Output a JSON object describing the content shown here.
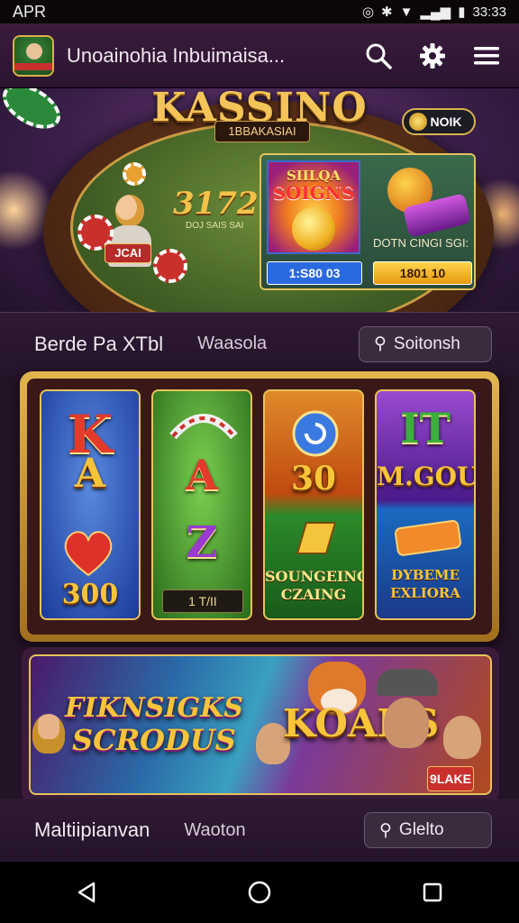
{
  "status_bar": {
    "left": "APR",
    "time": "33:33"
  },
  "app_bar": {
    "title": "Unoainohia Inbuimaisa..."
  },
  "hero": {
    "title": "KASSINO",
    "subtitle": "1BBAKASIAI",
    "felt_number": "3172",
    "felt_small": "DOJ SAIS SAI",
    "chip_label": "JCAI",
    "badge": "NOIK",
    "promo": {
      "title1": "SIILQA",
      "title2": "SOIGNS",
      "label": "DOTN CINGI SGI:",
      "button1": "1:S80 03",
      "button2": "1801 10"
    }
  },
  "section1": {
    "text1": "Berde Pa XTbl",
    "text2": "Waasola",
    "button": "Soitonsh"
  },
  "slots": {
    "reels": [
      {
        "top": "K",
        "mid": "A",
        "bottom": "300"
      },
      {
        "top": "",
        "mid": "A",
        "bottom": "Z",
        "label": "1 T/II"
      },
      {
        "top": "",
        "mid": "30",
        "bottom": "SOUNGEING CZAING"
      },
      {
        "top": "IT",
        "mid": "M.GOU",
        "bottom": "DYBEME EXLIORA"
      }
    ]
  },
  "banner": {
    "title1": "FIKNSIGKS",
    "title2": "SCRODUS",
    "title3": "KOANS",
    "tag": "9LAKE"
  },
  "section2": {
    "text1": "Maltiipianvan",
    "text2": "Waoton",
    "button": "Glelto"
  }
}
